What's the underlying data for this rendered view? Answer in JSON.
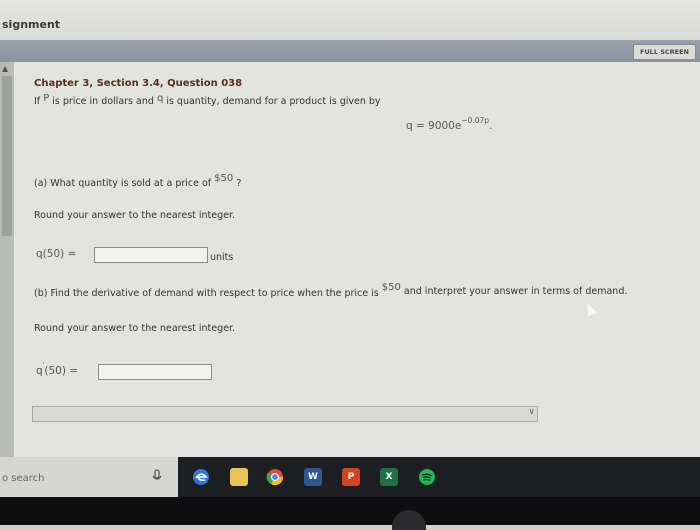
{
  "window": {
    "title": "signment"
  },
  "toolbar": {
    "full_screen": "FULL SCREEN"
  },
  "question": {
    "heading": "Chapter 3, Section 3.4, Question 038",
    "intro_if": "If",
    "var_p": "P",
    "intro_mid": "is price in dollars and",
    "var_q": "q",
    "intro_end": "is quantity, demand for a product is given by",
    "formula_base": "q = 9000e",
    "formula_exp": "−0.07p",
    "formula_end": ".",
    "part_a": {
      "prompt": "(a) What quantity is sold at a price of",
      "price": "$50",
      "end": "?",
      "round_note": "Round your answer to the nearest integer.",
      "label": "q(50) =",
      "value": "",
      "unit": "units"
    },
    "part_b": {
      "prompt": "(b) Find the derivative of demand with respect to price when the price is",
      "price": "$50",
      "rest": "and interpret your answer in terms of demand.",
      "round_note": "Round your answer to the nearest integer.",
      "label_q": "q",
      "label_prime": "′",
      "label_rest": "(50) =",
      "value": ""
    }
  },
  "taskbar": {
    "search_placeholder": "o search",
    "icons": [
      "mic-icon",
      "edge-icon",
      "file-explorer-icon",
      "chrome-icon",
      "word-icon",
      "powerpoint-icon",
      "excel-icon",
      "spotify-icon"
    ],
    "word_label": "W",
    "powerpoint_label": "P",
    "excel_label": "X"
  }
}
